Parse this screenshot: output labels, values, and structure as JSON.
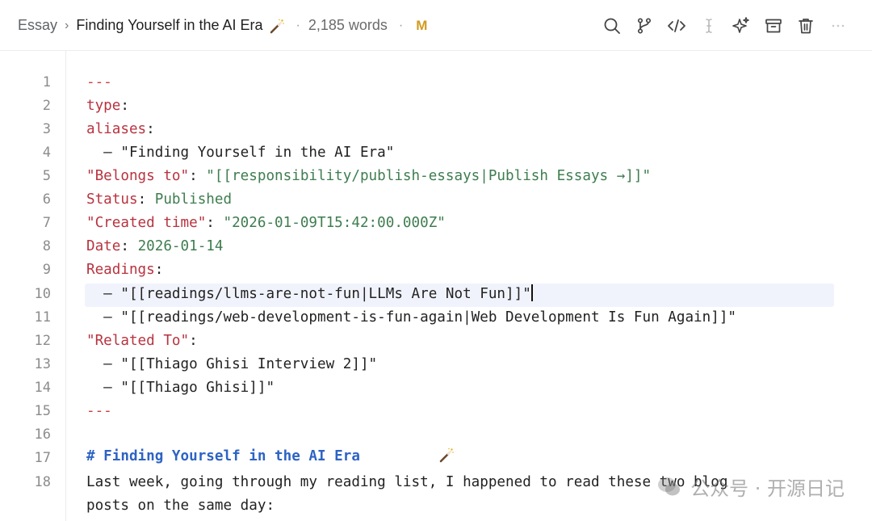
{
  "header": {
    "breadcrumb_root": "Essay",
    "breadcrumb_separator": "›",
    "title": "Finding Yourself in the AI Era",
    "separator_dot": "·",
    "word_count": "2,185 words",
    "status_letter": "M"
  },
  "toolbar": {
    "icons": [
      "search-icon",
      "branch-icon",
      "code-icon",
      "text-cursor-icon",
      "sparkle-icon",
      "archive-icon",
      "trash-icon",
      "more-icon"
    ],
    "accent_color": "#d19b1f"
  },
  "editor": {
    "line_numbers": [
      "1",
      "2",
      "3",
      "4",
      "5",
      "6",
      "7",
      "8",
      "9",
      "10",
      "11",
      "12",
      "13",
      "14",
      "15",
      "16",
      "17",
      "18"
    ],
    "lines": {
      "l1": "---",
      "l2_key": "type",
      "l2_colon": ":",
      "l3_key": "aliases",
      "l3_colon": ":",
      "l4": "  – \"Finding Yourself in the AI Era\"",
      "l5_key": "\"Belongs to\"",
      "l5_colon": ": ",
      "l5_value": "\"[[responsibility/publish-essays|Publish Essays →]]\"",
      "l6_key": "Status",
      "l6_colon": ": ",
      "l6_value": "Published",
      "l7_key": "\"Created time\"",
      "l7_colon": ": ",
      "l7_value": "\"2026-01-09T15:42:00.000Z\"",
      "l8_key": "Date",
      "l8_colon": ": ",
      "l8_value": "2026-01-14",
      "l9_key": "Readings",
      "l9_colon": ":",
      "l10": "  – \"[[readings/llms-are-not-fun|LLMs Are Not Fun]]\"",
      "l11": "  – \"[[readings/web-development-is-fun-again|Web Development Is Fun Again]]\"",
      "l12_key": "\"Related To\"",
      "l12_colon": ":",
      "l13": "  – \"[[Thiago Ghisi Interview 2]]\"",
      "l14": "  – \"[[Thiago Ghisi]]\"",
      "l15": "---",
      "l16": "# Finding Yourself in the AI Era",
      "l18a": "Last week, going through my reading list, I happened to read these two blog",
      "l18b": "posts on the same day:"
    }
  },
  "watermark": {
    "text": "公众号 · 开源日记"
  }
}
